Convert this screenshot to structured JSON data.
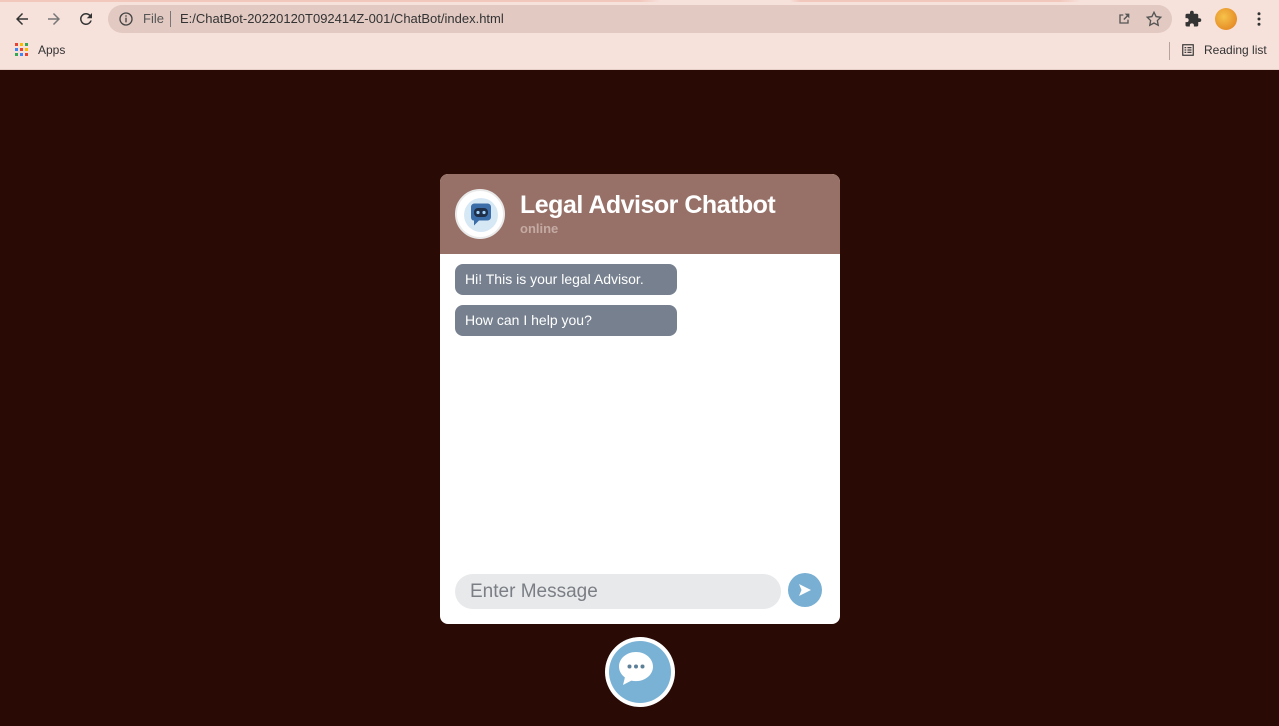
{
  "browser": {
    "scheme_label": "File",
    "url": "E:/ChatBot-20220120T092414Z-001/ChatBot/index.html",
    "bookmarks": {
      "apps_label": "Apps",
      "reading_list_label": "Reading list"
    },
    "icons": [
      "back-icon",
      "forward-icon",
      "reload-icon",
      "info-icon",
      "share-icon",
      "star-icon",
      "extensions-icon",
      "profile-icon",
      "menu-icon",
      "apps-icon",
      "reading-list-icon"
    ]
  },
  "chat": {
    "title": "Legal Advisor Chatbot",
    "status": "online",
    "messages": [
      {
        "sender": "bot",
        "text": "Hi! This is your legal Advisor."
      },
      {
        "sender": "bot",
        "text": "How can I help you?"
      }
    ],
    "input": {
      "placeholder": "Enter Message",
      "value": ""
    },
    "icons": [
      "bot-avatar-icon",
      "send-icon",
      "chat-bubble-icon"
    ]
  },
  "colors": {
    "page_background": "#2a0a05",
    "header_background": "#977168",
    "bot_bubble": "#76808f",
    "send_button": "#78afd2",
    "browser_chrome": "#f6e1db"
  }
}
